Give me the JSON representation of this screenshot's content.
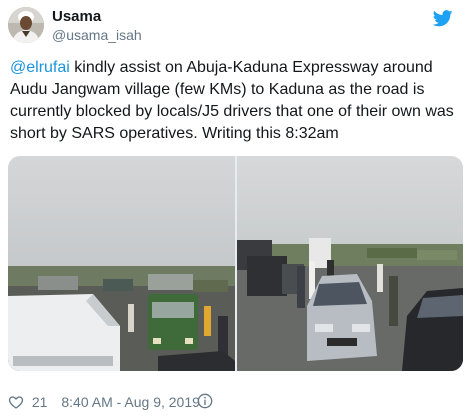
{
  "author": {
    "display_name": "Usama",
    "handle": "@usama_isah",
    "avatar_icon": "avatar"
  },
  "brand_icon": "twitter-bird-icon",
  "tweet": {
    "mention": "@elrufai",
    "text": " kindly assist on Abuja-Kaduna Expressway around Audu Jangwam village (few KMs) to Kaduna as the road is currently blocked by locals/J5 drivers that one of their own was short by SARS operatives. Writing this 8:32am"
  },
  "media": {
    "photo_count": 2
  },
  "footer": {
    "like_count": "21",
    "timestamp": "8:40 AM - Aug 9, 2019"
  },
  "colors": {
    "accent": "#1da1f2",
    "link": "#1b95e0",
    "secondary_text": "#657786",
    "primary_text": "#14171a"
  }
}
